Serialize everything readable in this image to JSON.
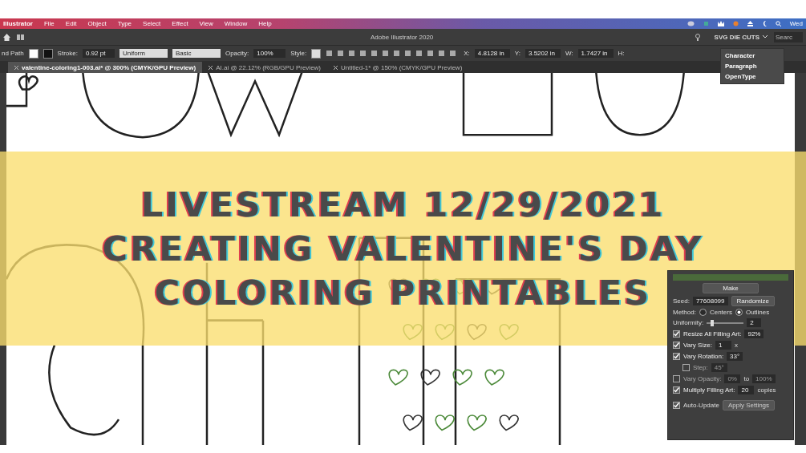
{
  "menu_bar": {
    "app": "Illustrator",
    "items": [
      "File",
      "Edit",
      "Object",
      "Type",
      "Select",
      "Effect",
      "View",
      "Window",
      "Help"
    ],
    "clock": "Wed"
  },
  "app_bar": {
    "title": "Adobe Illustrator 2020",
    "workspace": "SVG DIE CUTS",
    "search_placeholder": "Searc"
  },
  "control_bar": {
    "selection": "nd Path",
    "stroke_label": "Stroke:",
    "stroke_value": "0.92 pt",
    "profile": "Uniform",
    "brush": "Basic",
    "opacity_label": "Opacity:",
    "opacity_value": "100%",
    "style_label": "Style:",
    "x_label": "X:",
    "x_value": "4.8128 in",
    "y_label": "Y:",
    "y_value": "3.5202 in",
    "w_label": "W:",
    "w_value": "1.7427 in",
    "h_label": "H:"
  },
  "tabs": [
    {
      "label": "valentine-coloring1-003.ai* @ 300% (CMYK/GPU Preview)",
      "selected": true
    },
    {
      "label": "AI.ai @ 22.12% (RGB/GPU Preview)",
      "selected": false
    },
    {
      "label": "Untitled-1* @ 150% (CMYK/GPU Preview)",
      "selected": false
    }
  ],
  "type_menu": [
    "Character",
    "Paragraph",
    "OpenType"
  ],
  "fill_panel": {
    "make": "Make",
    "seed_label": "Seed:",
    "seed": "77608099",
    "randomize": "Randomize",
    "method_label": "Method:",
    "methods": [
      {
        "label": "Centers",
        "selected": false
      },
      {
        "label": "Outlines",
        "selected": true
      }
    ],
    "uniformity_label": "Uniformity:",
    "uniformity": {
      "level": 0.15
    },
    "uniformity_value": "2",
    "options": [
      {
        "label": "Resize All Filling Art:",
        "checked": true,
        "value": "92%"
      },
      {
        "label": "Vary Size:",
        "checked": true,
        "value": "1",
        "unit": "x"
      },
      {
        "label": "Vary Rotation:",
        "checked": true,
        "value": "33°",
        "children": [
          {
            "label": "Step:",
            "checked": false,
            "value": "45°"
          }
        ]
      },
      {
        "label": "Vary Opacity:",
        "checked": false,
        "value": "0%",
        "unit": "to",
        "value2": "100%"
      },
      {
        "label": "Multiply Filling Art:",
        "checked": true,
        "value": "20",
        "unit": "copies"
      }
    ],
    "auto_update": {
      "label": "Auto-Update",
      "checked": true
    },
    "apply": "Apply Settings"
  },
  "banner": {
    "lines": [
      "LIVESTREAM 12/29/2021",
      "CREATING VALENTINE'S DAY",
      "COLORING PRINTABLES"
    ]
  }
}
